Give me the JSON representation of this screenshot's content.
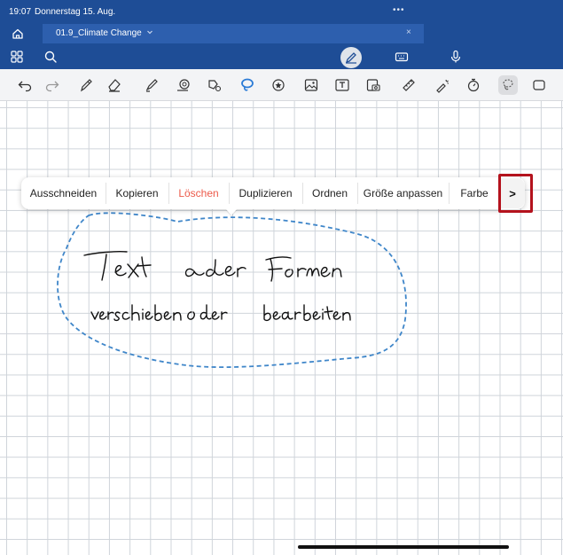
{
  "status_bar": {
    "time": "19:07",
    "date": "Donnerstag 15. Aug.",
    "dots": "•••"
  },
  "tab_bar": {
    "document_title": "01.9_Climate Change",
    "close": "×"
  },
  "top_toolbar": {
    "icons": [
      "grid-icon",
      "search-icon",
      "pencil-mode-icon",
      "keyboard-icon",
      "microphone-icon"
    ]
  },
  "drawing_toolbar": {
    "tools": [
      "undo-icon",
      "redo-icon",
      "pen-icon",
      "eraser-icon",
      "highlighter-icon",
      "shape-eraser-icon",
      "lasso-shape-icon",
      "lasso-icon",
      "sticker-icon",
      "image-icon",
      "text-box-icon",
      "camera-icon",
      "ruler-icon",
      "laser-pointer-icon",
      "timer-icon",
      "selection-icon",
      "shape-icon"
    ],
    "accent_color": "#2b7bd6"
  },
  "context_menu": {
    "items": [
      "Ausschneiden",
      "Kopieren",
      "Löschen",
      "Duplizieren",
      "Ordnen",
      "Größe anpassen",
      "Farbe"
    ],
    "more": ">",
    "delete_color": "#ec5a4a"
  },
  "colors": {
    "header_blue": "#1e4d96",
    "tab_blue": "#2d5fae",
    "highlight_red": "#b4121d",
    "lasso_blue": "#3f86c9"
  }
}
